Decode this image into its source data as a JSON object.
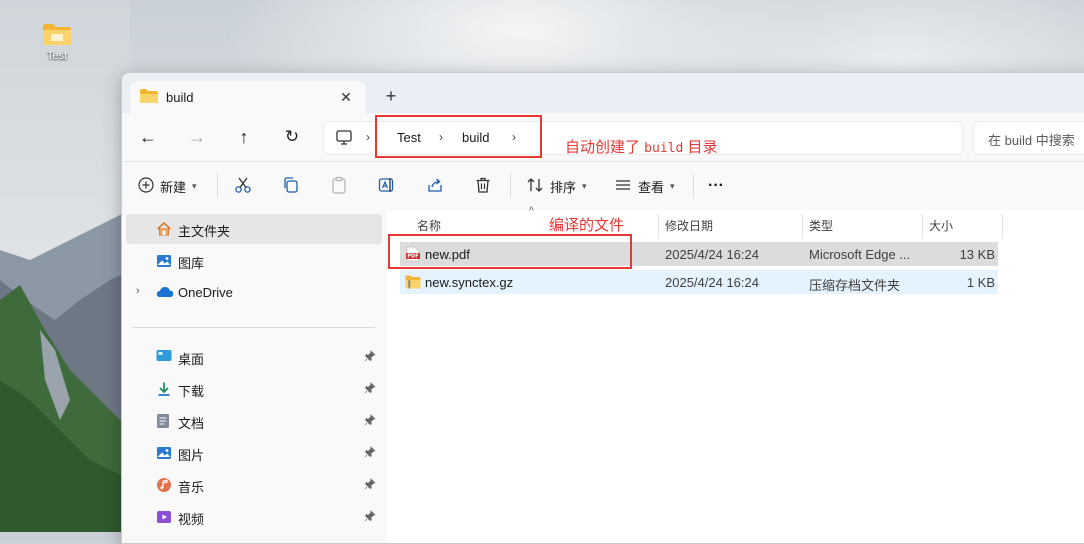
{
  "desktop": {
    "icon_label": "Test"
  },
  "tab": {
    "title": "build",
    "close": "✕",
    "new": "+"
  },
  "nav": {
    "back": "←",
    "forward": "→",
    "up": "↑",
    "refresh": "↻",
    "breadcrumb": [
      "Test",
      "build"
    ],
    "crumb_sep": "›",
    "search_placeholder": "在 build 中搜索"
  },
  "toolbar": {
    "new_label": "新建",
    "sort_label": "排序",
    "view_label": "查看",
    "more": "···"
  },
  "sidebar": {
    "home": "主文件夹",
    "gallery": "图库",
    "onedrive": "OneDrive",
    "quick": [
      "桌面",
      "下载",
      "文档",
      "图片",
      "音乐",
      "视频"
    ]
  },
  "columns": {
    "name": "名称",
    "modified": "修改日期",
    "type": "类型",
    "size": "大小"
  },
  "files": [
    {
      "name": "new.pdf",
      "modified": "2025/4/24 16:24",
      "type": "Microsoft Edge ...",
      "size": "13 KB"
    },
    {
      "name": "new.synctex.gz",
      "modified": "2025/4/24 16:24",
      "type": "压缩存档文件夹",
      "size": "1 KB"
    }
  ],
  "annotations": {
    "build_dir_prefix": "自动创建了 ",
    "build_dir_code": "build",
    "build_dir_suffix": " 目录",
    "compiled_file": "编译的文件"
  },
  "colors": {
    "annotation": "#e53935",
    "accent": "#0067c0",
    "folder": "#f8c84e"
  }
}
